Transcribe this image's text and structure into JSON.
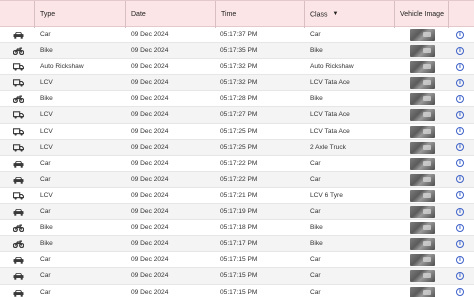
{
  "columns": {
    "type": "Type",
    "date": "Date",
    "time": "Time",
    "class": "Class",
    "vehicle_image": "Vehicle Image"
  },
  "rows": [
    {
      "icon": "car-icon",
      "type": "Car",
      "date": "09 Dec 2024",
      "time": "05:17:37 PM",
      "class": "Car"
    },
    {
      "icon": "bike-icon",
      "type": "Bike",
      "date": "09 Dec 2024",
      "time": "05:17:35 PM",
      "class": "Bike"
    },
    {
      "icon": "truck-icon",
      "type": "Auto Rickshaw",
      "date": "09 Dec 2024",
      "time": "05:17:32 PM",
      "class": "Auto Rickshaw"
    },
    {
      "icon": "truck-icon",
      "type": "LCV",
      "date": "09 Dec 2024",
      "time": "05:17:32 PM",
      "class": "LCV Tata Ace"
    },
    {
      "icon": "bike-icon",
      "type": "Bike",
      "date": "09 Dec 2024",
      "time": "05:17:28 PM",
      "class": "Bike"
    },
    {
      "icon": "truck-icon",
      "type": "LCV",
      "date": "09 Dec 2024",
      "time": "05:17:27 PM",
      "class": "LCV Tata Ace"
    },
    {
      "icon": "truck-icon",
      "type": "LCV",
      "date": "09 Dec 2024",
      "time": "05:17:25 PM",
      "class": "LCV Tata Ace"
    },
    {
      "icon": "truck-icon",
      "type": "LCV",
      "date": "09 Dec 2024",
      "time": "05:17:25 PM",
      "class": "2 Axle Truck"
    },
    {
      "icon": "car-icon",
      "type": "Car",
      "date": "09 Dec 2024",
      "time": "05:17:22 PM",
      "class": "Car"
    },
    {
      "icon": "car-icon",
      "type": "Car",
      "date": "09 Dec 2024",
      "time": "05:17:22 PM",
      "class": "Car"
    },
    {
      "icon": "truck-icon",
      "type": "LCV",
      "date": "09 Dec 2024",
      "time": "05:17:21 PM",
      "class": "LCV 6 Tyre"
    },
    {
      "icon": "car-icon",
      "type": "Car",
      "date": "09 Dec 2024",
      "time": "05:17:19 PM",
      "class": "Car"
    },
    {
      "icon": "bike-icon",
      "type": "Bike",
      "date": "09 Dec 2024",
      "time": "05:17:18 PM",
      "class": "Bike"
    },
    {
      "icon": "bike-icon",
      "type": "Bike",
      "date": "09 Dec 2024",
      "time": "05:17:17 PM",
      "class": "Bike"
    },
    {
      "icon": "car-icon",
      "type": "Car",
      "date": "09 Dec 2024",
      "time": "05:17:15 PM",
      "class": "Car"
    },
    {
      "icon": "car-icon",
      "type": "Car",
      "date": "09 Dec 2024",
      "time": "05:17:15 PM",
      "class": "Car"
    },
    {
      "icon": "car-icon",
      "type": "Car",
      "date": "09 Dec 2024",
      "time": "05:17:15 PM",
      "class": "Car"
    }
  ]
}
